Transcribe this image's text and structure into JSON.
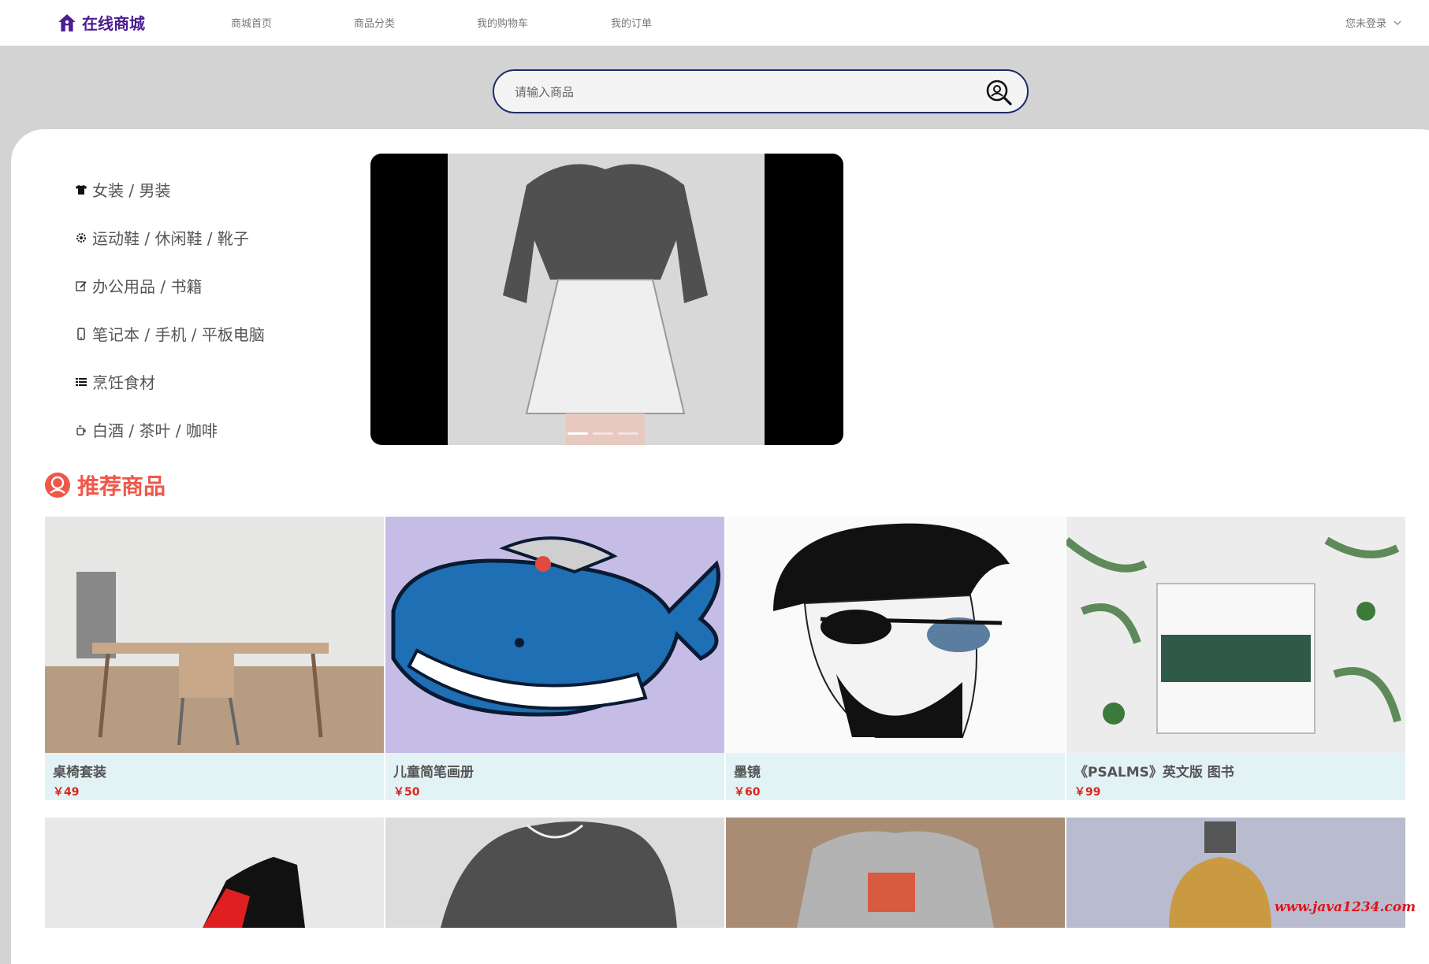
{
  "header": {
    "logo_text": "在线商城",
    "nav": [
      "商城首页",
      "商品分类",
      "我的购物车",
      "我的订单"
    ],
    "user_status": "您未登录"
  },
  "search": {
    "placeholder": "请输入商品"
  },
  "categories": [
    {
      "icon": "tshirt-icon",
      "label": "女装 / 男装"
    },
    {
      "icon": "gear-icon",
      "label": "运动鞋 / 休闲鞋 / 靴子"
    },
    {
      "icon": "edit-icon",
      "label": "办公用品 / 书籍"
    },
    {
      "icon": "phone-icon",
      "label": "笔记本 / 手机 / 平板电脑"
    },
    {
      "icon": "list-icon",
      "label": "烹饪食材"
    },
    {
      "icon": "cup-icon",
      "label": "白酒 / 茶叶 / 咖啡"
    }
  ],
  "carousel": {
    "dots": 3,
    "active_index": 0
  },
  "recommend": {
    "title": "推荐商品",
    "products": [
      {
        "name": "桌椅套装",
        "price": "￥49"
      },
      {
        "name": "儿童简笔画册",
        "price": "￥50"
      },
      {
        "name": "墨镜",
        "price": "￥60"
      },
      {
        "name": "《PSALMS》英文版 图书",
        "price": "￥99"
      }
    ]
  },
  "watermark": "www.java1234.com",
  "colors": {
    "brand": "#4b1d8f",
    "accent": "#f0574a",
    "price": "#d9261c",
    "search_border": "#1d2b6b",
    "card_info_bg": "#e3f3f5"
  }
}
